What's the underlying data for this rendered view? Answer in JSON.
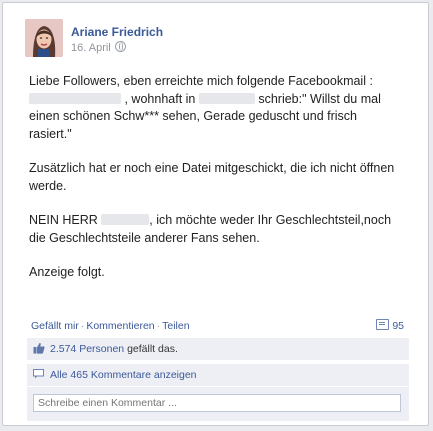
{
  "post": {
    "author": "Ariane Friedrich",
    "date": "16. April",
    "paragraphs": {
      "p1_a": "Liebe Followers, eben erreichte mich folgende Facebookmail :",
      "p1_b": ", wohnhaft in",
      "p1_c": "schrieb:\" Willst du mal",
      "p1_d": "einen schönen Schw*** sehen, Gerade geduscht und frisch",
      "p1_e": "rasiert.\"",
      "p2": "Zusätzlich hat er noch eine Datei mitgeschickt, die ich nicht öffnen werde.",
      "p3_a": "NEIN HERR",
      "p3_b": ", ich möchte weder Ihr Geschlechtsteil,noch",
      "p3_c": "die Geschlechtsteile anderer Fans sehen.",
      "p4": "Anzeige folgt."
    }
  },
  "actions": {
    "like": "Gefällt mir",
    "sep": "·",
    "comment": "Kommentieren",
    "share": "Teilen",
    "comment_count": "95"
  },
  "likes": {
    "count_link": "2.574 Personen",
    "suffix": "gefällt das."
  },
  "view_comments": "Alle 465 Kommentare anzeigen",
  "comment_input": {
    "placeholder": "Schreibe einen Kommentar ..."
  },
  "colors": {
    "link": "#3b5998",
    "meta": "#90949c",
    "row_bg": "#edeff4"
  }
}
